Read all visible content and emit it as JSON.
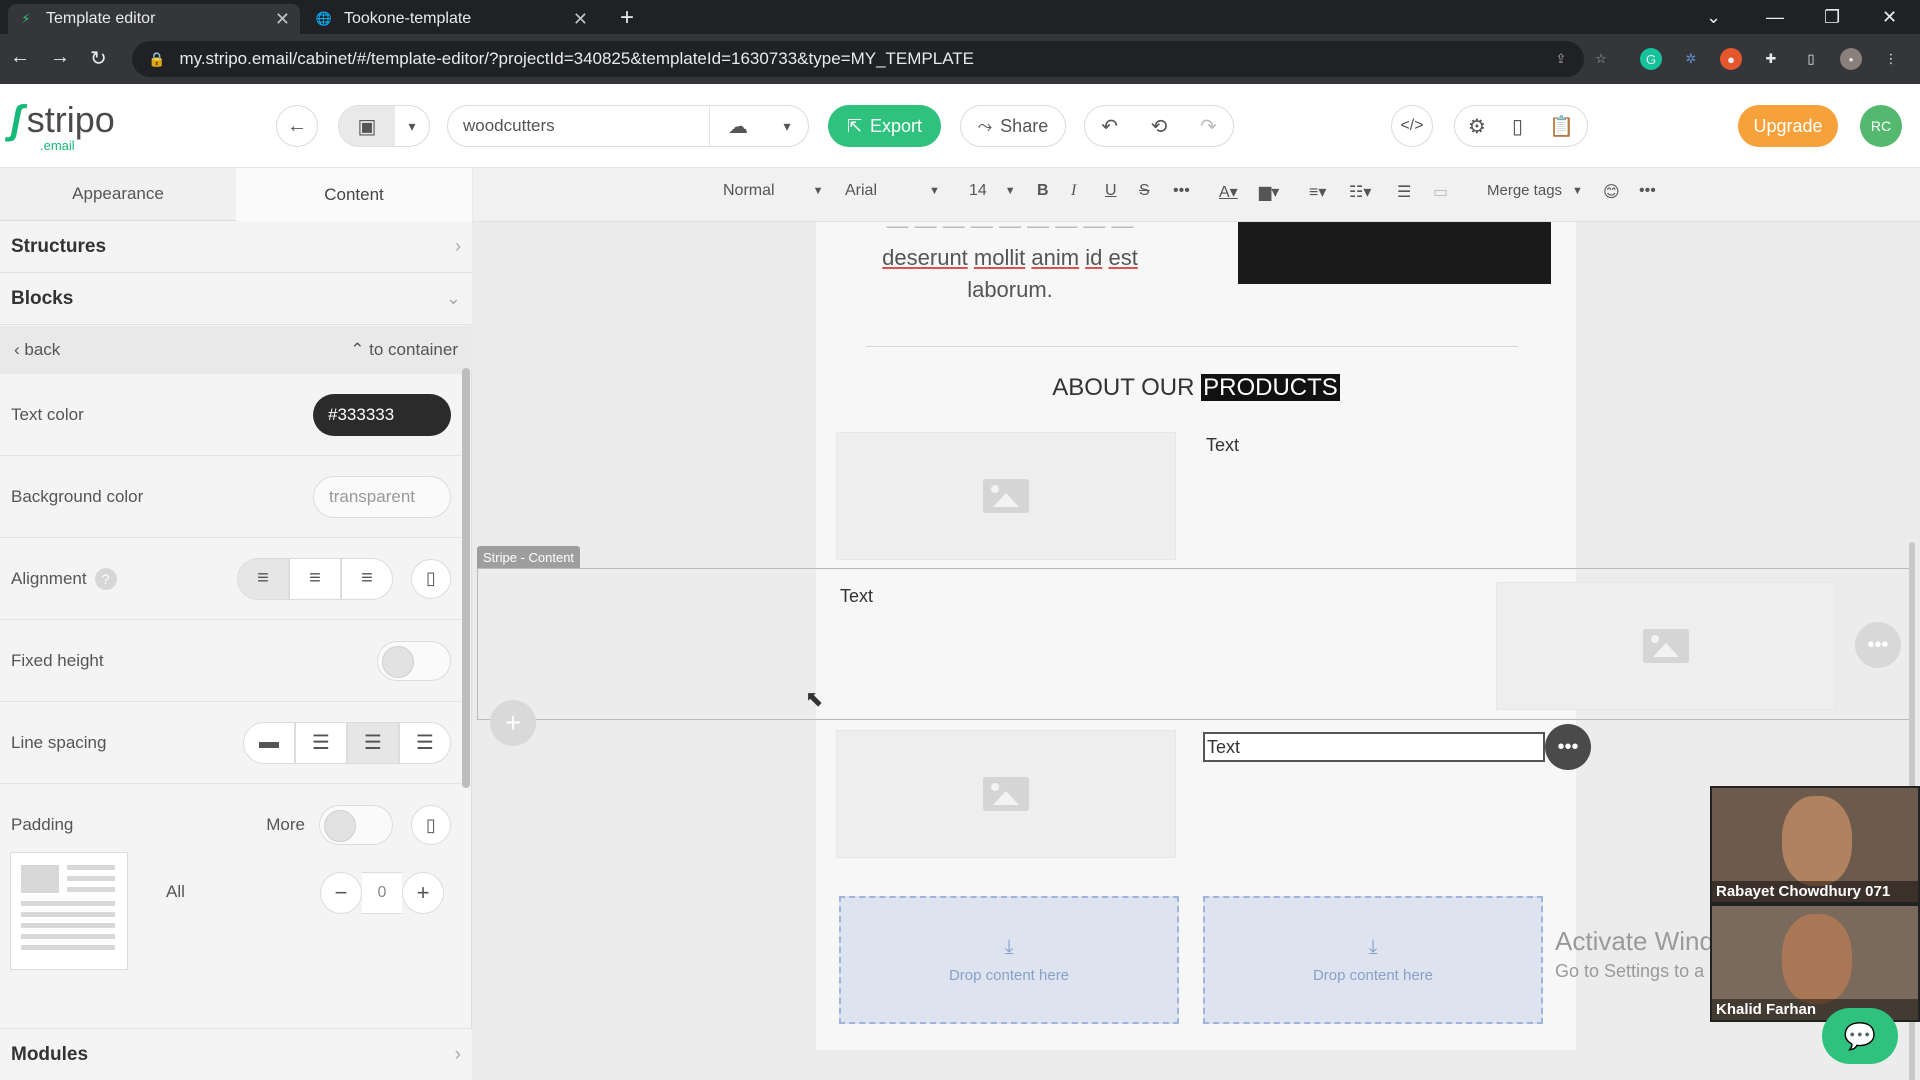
{
  "browser": {
    "tabs": [
      {
        "title": "Template editor",
        "active": true
      },
      {
        "title": "Tookone-template",
        "active": false
      }
    ],
    "url": "my.stripo.email/cabinet/#/template-editor/?projectId=340825&templateId=1630733&type=MY_TEMPLATE"
  },
  "header": {
    "logo_word": "stripo",
    "logo_sub": ".email",
    "template_name": "woodcutters",
    "export_label": "Export",
    "share_label": "Share",
    "upgrade_label": "Upgrade",
    "avatar_initials": "RC"
  },
  "panel": {
    "tabs": [
      "Appearance",
      "Content"
    ],
    "sections": {
      "structures": "Structures",
      "blocks": "Blocks",
      "modules": "Modules"
    },
    "back_label": "back",
    "to_container_label": "to container",
    "props": {
      "text_color_label": "Text color",
      "text_color_value": "#333333",
      "bg_color_label": "Background color",
      "bg_color_value": "transparent",
      "alignment_label": "Alignment",
      "fixed_height_label": "Fixed height",
      "line_spacing_label": "Line spacing",
      "padding_label": "Padding",
      "padding_more_label": "More",
      "padding_all_label": "All",
      "padding_value": "0"
    }
  },
  "toolbar": {
    "format": "Normal",
    "font": "Arial",
    "size": "14",
    "merge_tags": "Merge tags"
  },
  "canvas": {
    "intro_words": [
      "deserunt",
      "mollit",
      "anim",
      "id",
      "est"
    ],
    "intro_last": "laborum.",
    "heading_plain": "ABOUT OUR ",
    "heading_selected": "PRODUCTS",
    "text_1": "Text",
    "text_2": "Text",
    "text_3": "Text",
    "stripe_label": "Stripe - Content",
    "drop_label_1": "Drop content here",
    "drop_label_2": "Drop content here"
  },
  "os": {
    "watermark_title": "Activate Wind",
    "watermark_sub": "Go to Settings to a"
  },
  "video": {
    "participant_1": "Rabayet Chowdhury 071",
    "participant_2": "Khalid Farhan"
  },
  "colors": {
    "brand_green": "#2ec27e",
    "upgrade_orange": "#f7a13a",
    "text_color": "#333333"
  }
}
